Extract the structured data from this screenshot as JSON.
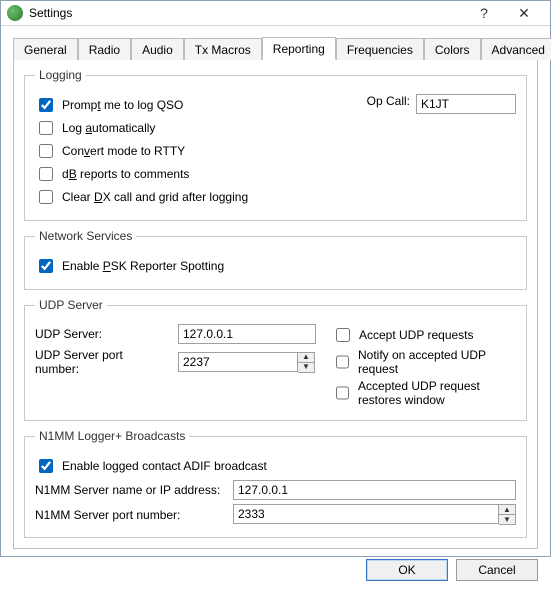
{
  "window": {
    "title": "Settings"
  },
  "tabs": {
    "general": "General",
    "radio": "Radio",
    "audio": "Audio",
    "txmacros": "Tx Macros",
    "reporting": "Reporting",
    "frequencies": "Frequencies",
    "colors": "Colors",
    "advanced": "Advanced",
    "active": "reporting"
  },
  "logging": {
    "legend": "Logging",
    "prompt_label_pre": "Promp",
    "prompt_label_u": "t",
    "prompt_label_post": " me to log QSO",
    "auto_label_pre": "Log ",
    "auto_label_u": "a",
    "auto_label_post": "utomatically",
    "rtty_label_pre": "Con",
    "rtty_label_u": "v",
    "rtty_label_post": "ert mode to RTTY",
    "db_label_pre": "d",
    "db_label_u": "B",
    "db_label_post": " reports to comments",
    "clear_label_pre": "Clear ",
    "clear_label_u": "D",
    "clear_label_post": "X call and grid after logging",
    "opcall_label": "Op Call:",
    "opcall_value": "K1JT"
  },
  "network": {
    "legend": "Network Services",
    "psk_label_pre": "Enable ",
    "psk_label_u": "P",
    "psk_label_post": "SK Reporter Spotting"
  },
  "udp": {
    "legend": "UDP Server",
    "server_label": "UDP Server:",
    "server_value": "127.0.0.1",
    "port_label": "UDP Server port number:",
    "port_value": "2237",
    "accept_label": "Accept UDP requests",
    "notify_label": "Notify on accepted UDP request",
    "restore_label": "Accepted UDP request restores window"
  },
  "n1mm": {
    "legend": "N1MM Logger+ Broadcasts",
    "enable_label": "Enable logged contact ADIF broadcast",
    "server_label": "N1MM Server name or IP address:",
    "server_value": "127.0.0.1",
    "port_label": "N1MM Server port number:",
    "port_value": "2333"
  },
  "buttons": {
    "ok": "OK",
    "cancel": "Cancel"
  }
}
